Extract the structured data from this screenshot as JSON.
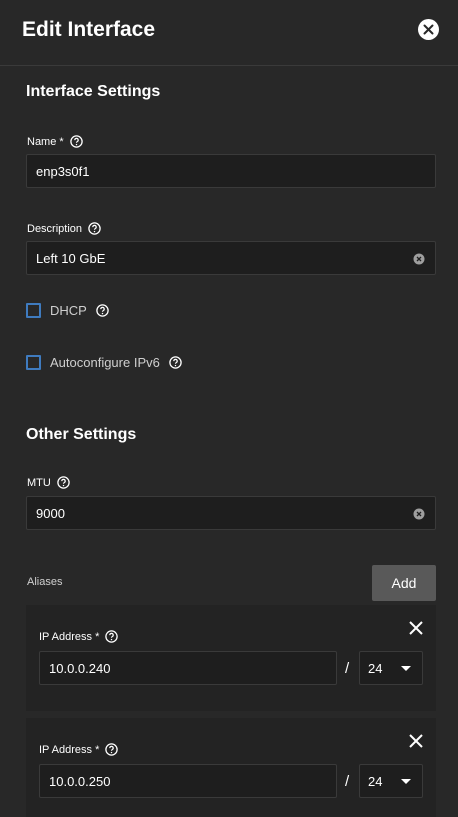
{
  "header": {
    "title": "Edit Interface",
    "close_icon": "close-circle-icon"
  },
  "interface_settings": {
    "title": "Interface Settings",
    "name": {
      "label": "Name",
      "required": "*",
      "value": "enp3s0f1"
    },
    "description": {
      "label": "Description",
      "value": "Left 10 GbE"
    },
    "dhcp": {
      "label": "DHCP",
      "checked": false
    },
    "autoconfigure_ipv6": {
      "label": "Autoconfigure IPv6",
      "checked": false
    }
  },
  "other_settings": {
    "title": "Other Settings",
    "mtu": {
      "label": "MTU",
      "value": "9000"
    }
  },
  "aliases": {
    "label": "Aliases",
    "add_label": "Add",
    "items": [
      {
        "ip_label": "IP Address",
        "required": "*",
        "ip": "10.0.0.240",
        "separator": "/",
        "netmask": "24"
      },
      {
        "ip_label": "IP Address",
        "required": "*",
        "ip": "10.0.0.250",
        "separator": "/",
        "netmask": "24"
      }
    ]
  },
  "colors": {
    "background": "#282828",
    "input_bg": "#1e1e1e",
    "checkbox_border": "#3f7bbf",
    "button_bg": "#595959"
  }
}
